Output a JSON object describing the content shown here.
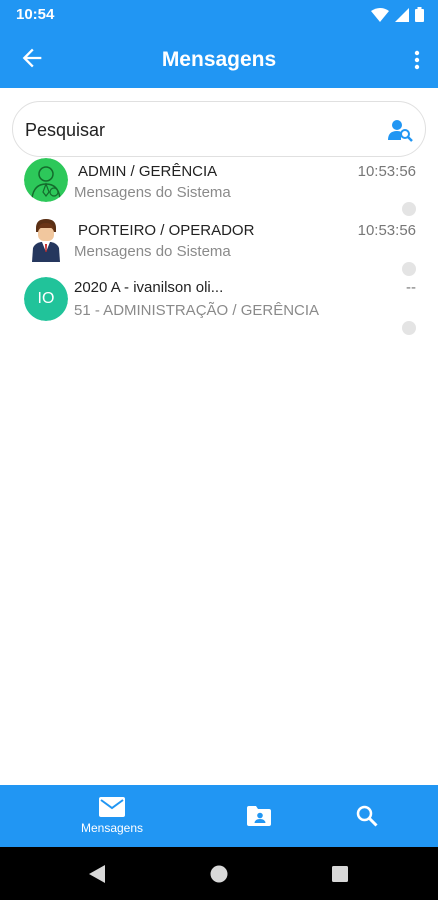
{
  "status_bar": {
    "time": "10:54"
  },
  "app_bar": {
    "title": "Mensagens"
  },
  "search": {
    "placeholder": "Pesquisar"
  },
  "conversations": [
    {
      "title": "ADMIN / GERÊNCIA",
      "subtitle": "Mensagens do Sistema",
      "time": "10:53:56",
      "avatar": "admin-avatar"
    },
    {
      "title": "PORTEIRO / OPERADOR",
      "subtitle": "Mensagens do Sistema",
      "time": "10:53:56",
      "avatar": "porteiro-avatar"
    },
    {
      "title": "2020 A - ivanilson oli...",
      "subtitle": "51 - ADMINISTRAÇÃO / GERÊNCIA",
      "time": "--",
      "initials": "IO"
    }
  ],
  "bottom_nav": {
    "messages_label": "Mensagens"
  },
  "colors": {
    "primary": "#2196f3",
    "avatar_green": "#21c39a",
    "admin_green": "#2dc85a"
  }
}
